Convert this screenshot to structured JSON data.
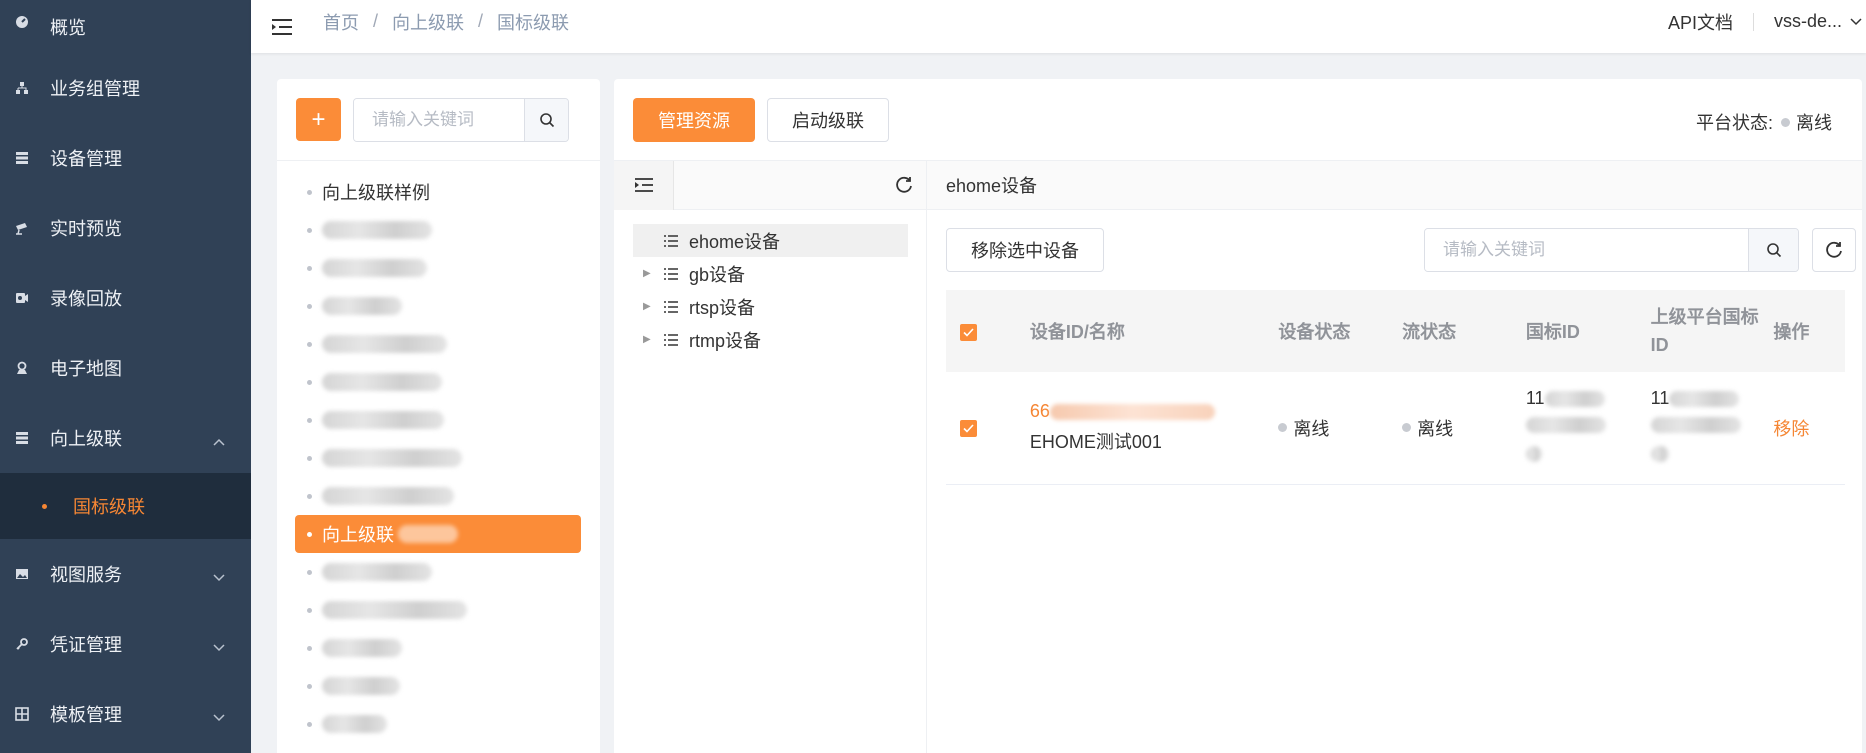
{
  "sidebar": {
    "items": [
      {
        "label": "概览",
        "icon": "dashboard-icon"
      },
      {
        "label": "业务组管理",
        "icon": "org-icon"
      },
      {
        "label": "设备管理",
        "icon": "server-icon"
      },
      {
        "label": "实时预览",
        "icon": "camera-icon"
      },
      {
        "label": "录像回放",
        "icon": "video-icon"
      },
      {
        "label": "电子地图",
        "icon": "map-pin-icon"
      },
      {
        "label": "向上级联",
        "icon": "list-icon"
      },
      {
        "label": "视图服务",
        "icon": "image-icon"
      },
      {
        "label": "凭证管理",
        "icon": "key-icon"
      },
      {
        "label": "模板管理",
        "icon": "grid-icon"
      }
    ],
    "sub_active": "国标级联"
  },
  "topbar": {
    "breadcrumb": [
      "首页",
      "向上级联",
      "国标级联"
    ],
    "api_doc": "API文档",
    "user": "vss-de..."
  },
  "left_panel": {
    "add_label": "+",
    "search_placeholder": "请输入关键词",
    "tree": {
      "first": "向上级联样例",
      "active": "向上级联"
    }
  },
  "right_panel": {
    "manage_label": "管理资源",
    "cascade_label": "启动级联",
    "platform_status_label": "平台状态:",
    "platform_status_value": "离线",
    "device_tree": [
      "ehome设备",
      "gb设备",
      "rtsp设备",
      "rtmp设备"
    ],
    "table_title": "ehome设备",
    "remove_selected_label": "移除选中设备",
    "search_placeholder": "请输入关键词",
    "columns": [
      "设备ID/名称",
      "设备状态",
      "流状态",
      "国标ID",
      "上级平台国标ID",
      "操作"
    ],
    "rows": [
      {
        "id_prefix": "66",
        "name": "EHOME测试001",
        "device_status": "离线",
        "stream_status": "离线",
        "gb_id_prefix": "11",
        "parent_gb_id_prefix": "11",
        "action": "移除"
      }
    ]
  },
  "colors": {
    "accent": "#fb8c38",
    "sidebar": "#304156",
    "sidebar_sub": "#1f2d3d"
  }
}
